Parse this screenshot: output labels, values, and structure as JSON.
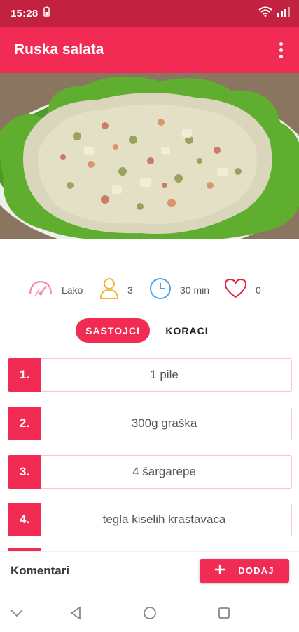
{
  "status_bar": {
    "time": "15:28"
  },
  "app_bar": {
    "title": "Ruska salata",
    "menu_icon": "more-vert-icon"
  },
  "hero": {
    "image_icon": "salad-photo"
  },
  "stats": {
    "difficulty": "Lako",
    "servings": "3",
    "time": "30 min",
    "likes": "0"
  },
  "tabs": {
    "active": "SASTOJCI",
    "inactive": "KORACI"
  },
  "ingredients": [
    {
      "num": "1.",
      "text": "1 pile"
    },
    {
      "num": "2.",
      "text": "300g graška"
    },
    {
      "num": "3.",
      "text": "4 šargarepe"
    },
    {
      "num": "4.",
      "text": "tegla kiselih krastavaca"
    }
  ],
  "comments": {
    "label": "Komentari",
    "add_label": "DODAJ"
  },
  "colors": {
    "accent": "#f22b55",
    "status_bar": "#c2213f"
  }
}
